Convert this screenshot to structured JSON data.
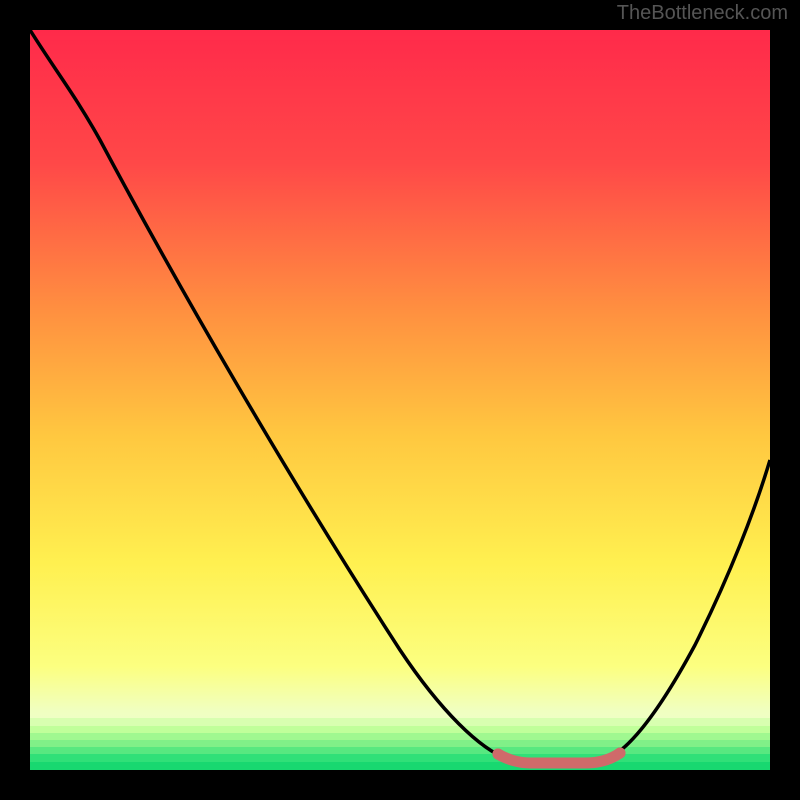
{
  "watermark": "TheBottleneck.com",
  "chart_data": {
    "type": "line",
    "title": "",
    "xlabel": "",
    "ylabel": "",
    "xlim": [
      0,
      100
    ],
    "ylim": [
      0,
      100
    ],
    "series": [
      {
        "name": "bottleneck-curve",
        "x": [
          0,
          5,
          15,
          30,
          45,
          55,
          62,
          67,
          72,
          76,
          80,
          88,
          100
        ],
        "y": [
          100,
          95,
          80,
          55,
          30,
          14,
          4,
          1,
          1,
          1,
          4,
          18,
          45
        ],
        "color": "#000000"
      }
    ],
    "highlight": {
      "name": "optimal-range",
      "x_start": 62,
      "x_end": 80,
      "color": "#d47070"
    },
    "gradient_colors": {
      "top": "#ff2f4f",
      "mid_upper": "#ff8040",
      "mid": "#ffd740",
      "mid_lower": "#ffff50",
      "lower": "#f8ffb0",
      "bottom": "#20e070"
    }
  }
}
